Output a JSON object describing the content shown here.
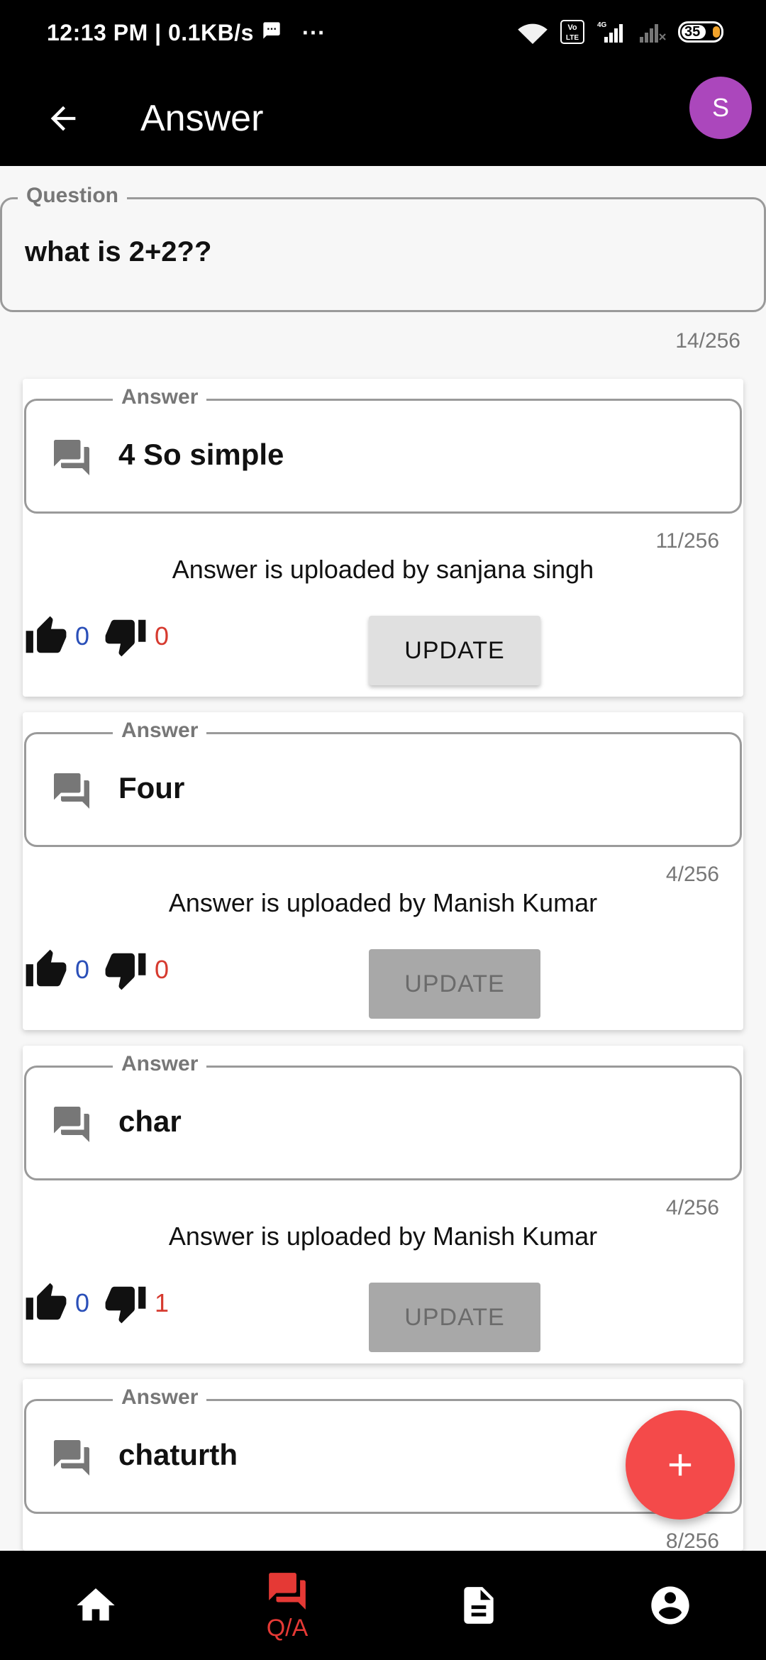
{
  "status": {
    "time_and_speed": "12:13 PM | 0.1KB/s",
    "more": "···",
    "battery_level": "35"
  },
  "appbar": {
    "title": "Answer",
    "avatar_letter": "S"
  },
  "question": {
    "label": "Question",
    "value": "what is 2+2??",
    "counter": "14/256"
  },
  "answers": [
    {
      "label": "Answer",
      "value": "4 So simple",
      "counter": "11/256",
      "uploader": "Answer is uploaded by sanjana singh",
      "likes": "0",
      "dislikes": "0",
      "update_label": "UPDATE",
      "update_enabled": true
    },
    {
      "label": "Answer",
      "value": "Four",
      "counter": "4/256",
      "uploader": "Answer is uploaded by Manish Kumar",
      "likes": "0",
      "dislikes": "0",
      "update_label": "UPDATE",
      "update_enabled": false
    },
    {
      "label": "Answer",
      "value": "char",
      "counter": "4/256",
      "uploader": "Answer is uploaded by Manish Kumar",
      "likes": "0",
      "dislikes": "1",
      "update_label": "UPDATE",
      "update_enabled": false
    },
    {
      "label": "Answer",
      "value": "chaturth",
      "counter": "8/256"
    }
  ],
  "bottom_nav": {
    "items": [
      {
        "icon": "home-icon",
        "label": ""
      },
      {
        "icon": "forum-icon",
        "label": "Q/A"
      },
      {
        "icon": "document-icon",
        "label": ""
      },
      {
        "icon": "account-icon",
        "label": ""
      }
    ]
  },
  "colors": {
    "accent": "#e53935",
    "fab": "#f44a4a",
    "avatar": "#ab47bc",
    "like": "#2a4fb8",
    "dislike": "#d63a2f"
  }
}
